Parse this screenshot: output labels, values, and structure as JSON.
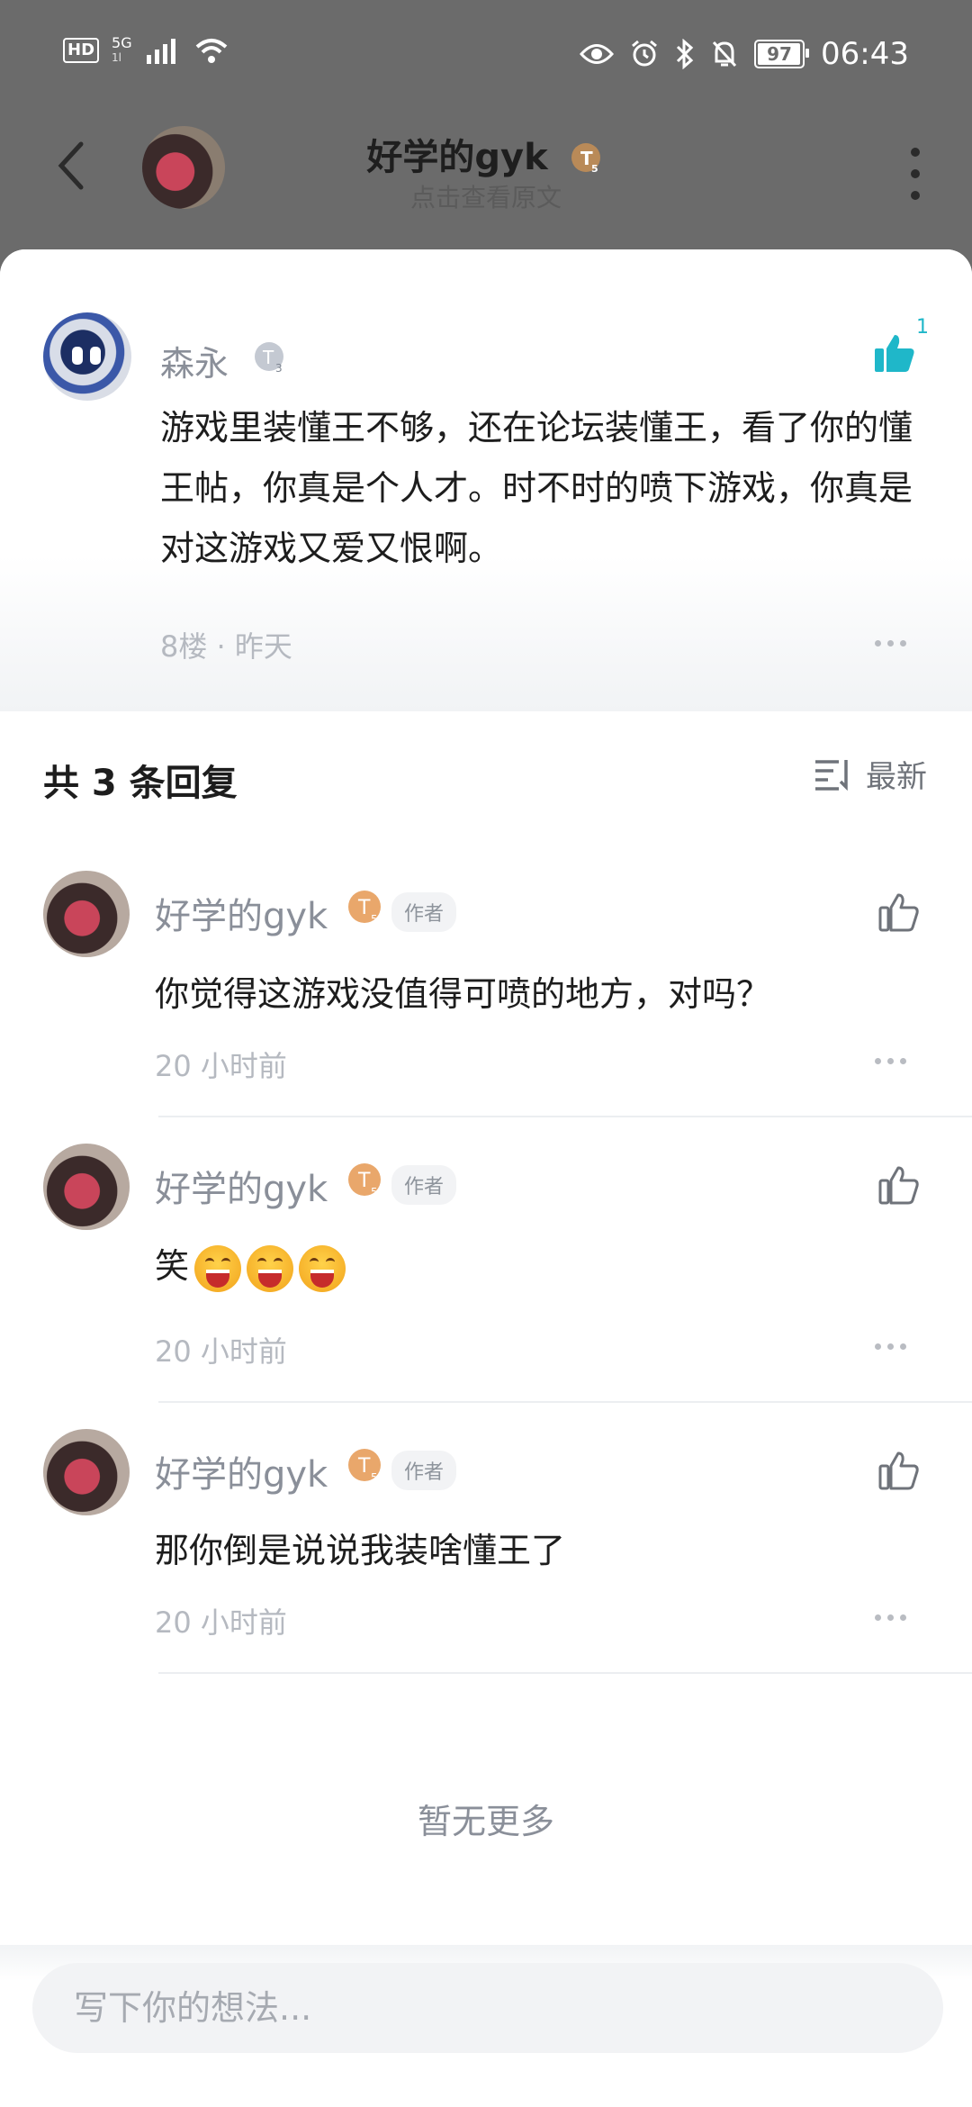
{
  "status_bar": {
    "hd": "HD",
    "network": "5G",
    "network_sub": "1l",
    "battery": "97",
    "battery_level": 0.97,
    "time": "06:43"
  },
  "header": {
    "title": "好学的gyk",
    "title_level": "T5",
    "subtitle": "点击查看原文"
  },
  "main_comment": {
    "author": "森永",
    "level": "T3",
    "like_count": "1",
    "text": "游戏里装懂王不够，还在论坛装懂王，看了你的懂王帖，你真是个人才。时不时的喷下游戏，你真是对这游戏又爱又恨啊。",
    "meta": "8楼 · 昨天"
  },
  "replies_section": {
    "title": "共 3 条回复",
    "sort_label": "最新"
  },
  "replies": [
    {
      "author": "好学的gyk",
      "level": "T5",
      "badge": "作者",
      "text": "你觉得这游戏没值得可喷的地方，对吗？",
      "time": "20 小时前"
    },
    {
      "author": "好学的gyk",
      "level": "T5",
      "badge": "作者",
      "text": "笑",
      "emoji_count": 3,
      "time": "20 小时前"
    },
    {
      "author": "好学的gyk",
      "level": "T5",
      "badge": "作者",
      "text": "那你倒是说说我装啥懂王了",
      "time": "20 小时前"
    }
  ],
  "end_note": "暂无更多",
  "composer": {
    "placeholder": "写下你的想法..."
  },
  "colors": {
    "accent_like": "#1fb7c9",
    "level_gold": "#e9a76b",
    "level_silver": "#c4c9d2"
  }
}
